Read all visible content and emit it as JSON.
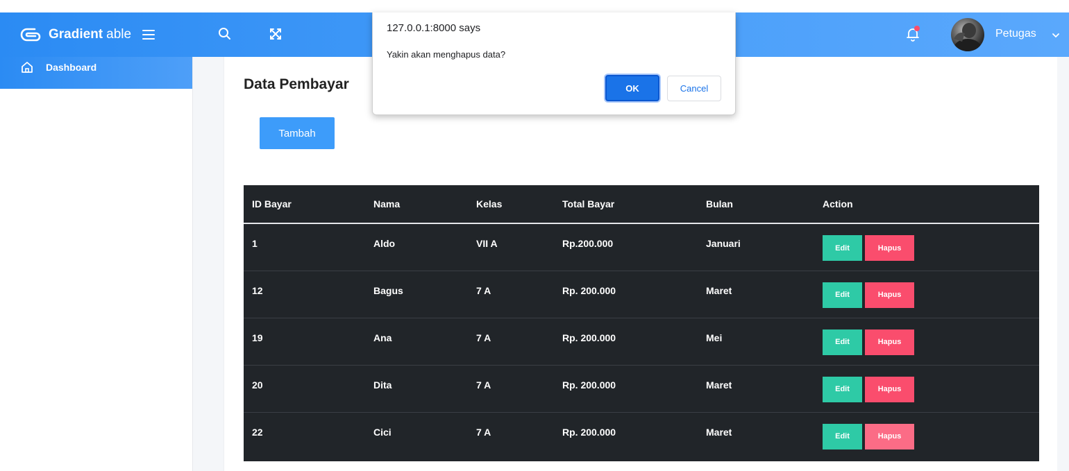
{
  "header": {
    "brand_bold": "Gradient",
    "brand_light": "able",
    "user_name": "Petugas",
    "notification_dot_color": "#fa4d6d"
  },
  "sidebar": {
    "items": [
      {
        "label": "Dashboard",
        "icon": "home-icon",
        "active": true
      }
    ]
  },
  "main": {
    "title": "Data Pembayar",
    "add_button": "Tambah"
  },
  "table": {
    "columns": [
      "ID Bayar",
      "Nama",
      "Kelas",
      "Total Bayar",
      "Bulan",
      "Action"
    ],
    "rows": [
      {
        "id": "1",
        "nama": "Aldo",
        "kelas": "VII A",
        "total": "Rp.200.000",
        "bulan": "Januari",
        "edit": "Edit",
        "hapus": "Hapus"
      },
      {
        "id": "12",
        "nama": "Bagus",
        "kelas": "7 A",
        "total": "Rp. 200.000",
        "bulan": "Maret",
        "edit": "Edit",
        "hapus": "Hapus"
      },
      {
        "id": "19",
        "nama": "Ana",
        "kelas": "7 A",
        "total": "Rp. 200.000",
        "bulan": "Mei",
        "edit": "Edit",
        "hapus": "Hapus"
      },
      {
        "id": "20",
        "nama": "Dita",
        "kelas": "7 A",
        "total": "Rp. 200.000",
        "bulan": "Maret",
        "edit": "Edit",
        "hapus": "Hapus"
      },
      {
        "id": "22",
        "nama": "Cici",
        "kelas": "7 A",
        "total": "Rp. 200.000",
        "bulan": "Maret",
        "edit": "Edit",
        "hapus": "Hapus"
      }
    ]
  },
  "dialog": {
    "origin": "127.0.0.1:8000 says",
    "message": "Yakin akan menghapus data?",
    "ok_label": "OK",
    "cancel_label": "Cancel"
  },
  "colors": {
    "primary": "#3d9cfa",
    "edit": "#2ecaa6",
    "hapus": "#fa4d6d",
    "table_bg": "#212529"
  }
}
